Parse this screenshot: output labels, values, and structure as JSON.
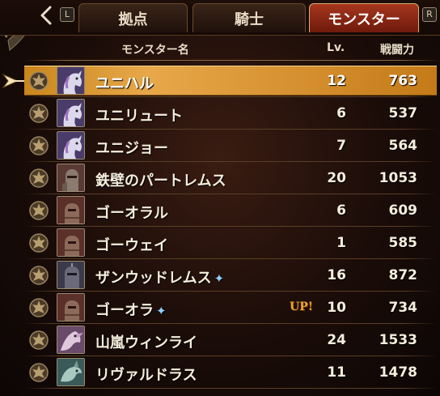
{
  "tabs": [
    {
      "label": "拠点",
      "active": false
    },
    {
      "label": "騎士",
      "active": false
    },
    {
      "label": "モンスター",
      "active": true
    }
  ],
  "key_hints": {
    "left": "L",
    "right": "R"
  },
  "columns": {
    "name": "モンスター名",
    "level": "Lv.",
    "power": "戦闘力"
  },
  "monsters": [
    {
      "name": "ユニハル",
      "level": "12",
      "power": "763",
      "selected": true,
      "portrait": "unicorn-icon",
      "sparkle": false,
      "up": ""
    },
    {
      "name": "ユニリュート",
      "level": "6",
      "power": "537",
      "selected": false,
      "portrait": "unicorn-icon",
      "sparkle": false,
      "up": ""
    },
    {
      "name": "ユニジョー",
      "level": "7",
      "power": "564",
      "selected": false,
      "portrait": "unicorn-icon",
      "sparkle": false,
      "up": ""
    },
    {
      "name": "鉄壁のパートレムス",
      "level": "20",
      "power": "1053",
      "selected": false,
      "portrait": "armored-knight-icon",
      "sparkle": false,
      "up": ""
    },
    {
      "name": "ゴーオラル",
      "level": "6",
      "power": "609",
      "selected": false,
      "portrait": "golem-icon",
      "sparkle": false,
      "up": ""
    },
    {
      "name": "ゴーウェイ",
      "level": "1",
      "power": "585",
      "selected": false,
      "portrait": "golem-icon",
      "sparkle": false,
      "up": ""
    },
    {
      "name": "ザンウッドレムス",
      "level": "16",
      "power": "872",
      "selected": false,
      "portrait": "dark-knight-icon",
      "sparkle": true,
      "up": ""
    },
    {
      "name": "ゴーオラ",
      "level": "10",
      "power": "734",
      "selected": false,
      "portrait": "golem-icon",
      "sparkle": true,
      "up": "UP!"
    },
    {
      "name": "山嵐ウィンライ",
      "level": "24",
      "power": "1533",
      "selected": false,
      "portrait": "griffin-icon",
      "sparkle": false,
      "up": ""
    },
    {
      "name": "リヴァルドラス",
      "level": "11",
      "power": "1478",
      "selected": false,
      "portrait": "dragon-icon",
      "sparkle": false,
      "up": ""
    }
  ],
  "colors": {
    "active_tab": "#a6361e",
    "selected_row": "#e8a84a",
    "up_badge": "#f0a830",
    "sparkle": "#8fd0ff"
  }
}
